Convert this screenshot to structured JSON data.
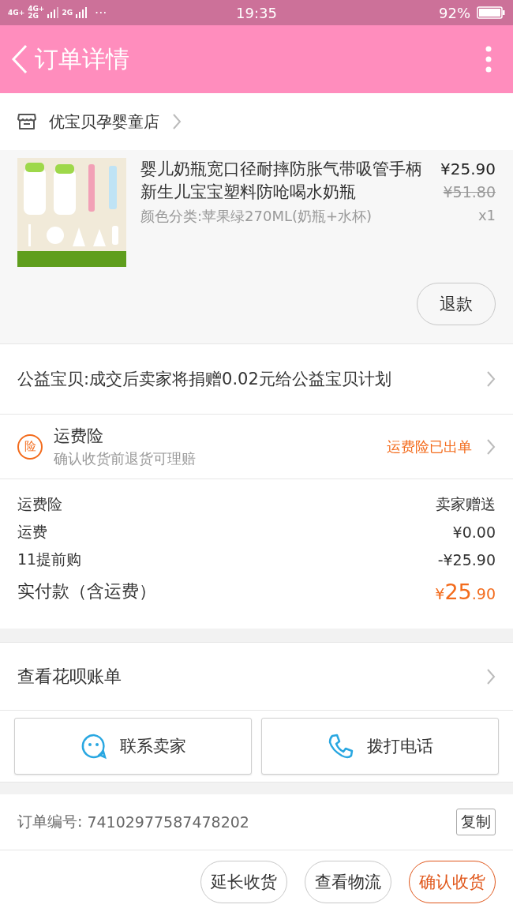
{
  "status_bar": {
    "networks": [
      "4G+",
      "4G+",
      "2G",
      "2G"
    ],
    "more": "···",
    "time": "19:35",
    "battery": "92%"
  },
  "header": {
    "title": "订单详情"
  },
  "store": {
    "name": "优宝贝孕婴童店"
  },
  "item": {
    "kind": "picture",
    "title": "婴儿奶瓶宽口径耐摔防胀气带吸管手柄新生儿宝宝塑料防呛喝水奶瓶",
    "variant": "颜色分类:苹果绿270ML(奶瓶+水杯)",
    "price": "¥25.90",
    "original_price": "¥51.80",
    "quantity": "x1",
    "refund_button": "退款"
  },
  "charity": {
    "text": "公益宝贝:成交后卖家将捐赠0.02元给公益宝贝计划"
  },
  "insurance": {
    "badge": "险",
    "title": "运费险",
    "subtitle": "确认收货前退货可理赔",
    "status": "运费险已出单"
  },
  "costs": [
    {
      "label": "运费险",
      "value": "卖家赠送",
      "kind": "plain"
    },
    {
      "label": "运费",
      "value": "¥0.00",
      "kind": "plain"
    },
    {
      "label": "11提前购",
      "value": "-¥25.90",
      "kind": "plain"
    },
    {
      "label": "实付款（含运费）",
      "value_symbol": "¥",
      "value_main": "25",
      "value_cents": ".90",
      "kind": "total"
    }
  ],
  "huabei": {
    "text": "查看花呗账单"
  },
  "contact_buttons": [
    {
      "label": "联系卖家",
      "kind": "chat"
    },
    {
      "label": "拨打电话",
      "kind": "phone"
    }
  ],
  "order": {
    "label": "订单编号:",
    "number": "74102977587478202",
    "copy_button": "复制"
  },
  "actions": [
    {
      "label": "延长收货",
      "primary": false
    },
    {
      "label": "查看物流",
      "primary": false
    },
    {
      "label": "确认收货",
      "primary": true
    }
  ]
}
